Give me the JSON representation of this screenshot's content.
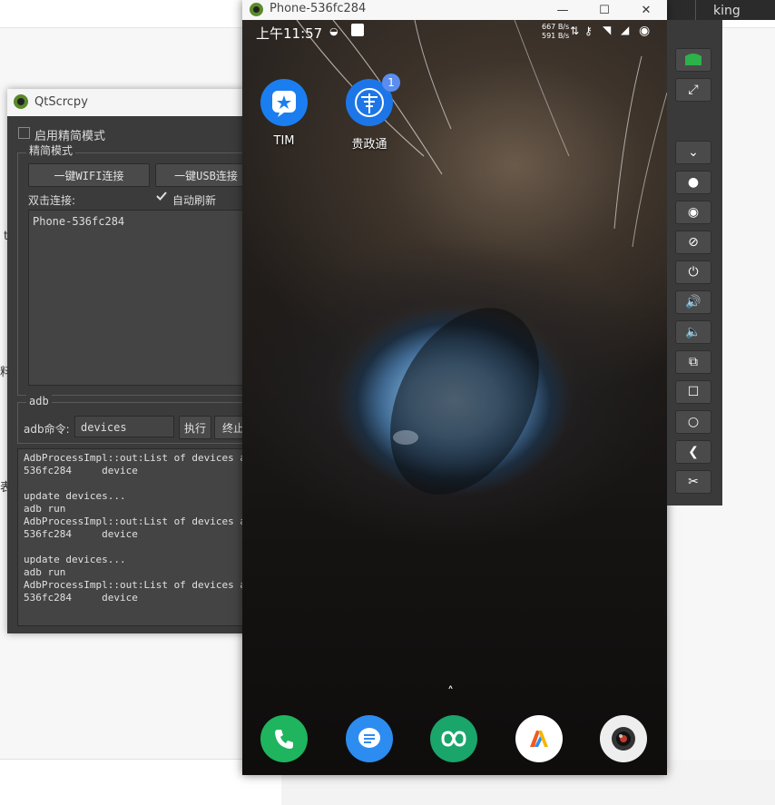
{
  "background": {
    "user_name": "king",
    "fragments": [
      "t",
      "料",
      "表"
    ]
  },
  "qtscrcpy": {
    "title": "QtScrcpy",
    "simple_mode_checkbox": "启用精简模式",
    "group_title": "精简模式",
    "wifi_button": "一键WIFI连接",
    "usb_button": "一键USB连接",
    "double_click_label": "双击连接:",
    "auto_refresh_label": "自动刷新",
    "auto_refresh_checked": true,
    "devices": [
      "Phone-536fc284"
    ],
    "adb_group_title": "adb",
    "adb_command_label": "adb命令:",
    "adb_command_value": "devices",
    "execute_button": "执行",
    "stop_button": "终止",
    "log_lines": [
      "AdbProcessImpl::out:List of devices attached",
      "536fc284     device",
      "",
      "update devices...",
      "adb run",
      "AdbProcessImpl::out:List of devices attached",
      "536fc284     device",
      "",
      "update devices...",
      "adb run",
      "AdbProcessImpl::out:List of devices attached",
      "536fc284     device"
    ]
  },
  "phone_window": {
    "title": "Phone-536fc284",
    "controls": {
      "minimize": "—",
      "maximize": "☐",
      "close": "✕"
    },
    "status_bar": {
      "time": "上午11:57",
      "speed_up": "667 B/s",
      "speed_down": "591 B/s"
    },
    "apps": [
      {
        "label": "TIM",
        "icon": "tim-icon",
        "badge": ""
      },
      {
        "label": "贵政通",
        "icon": "guizhengtong-icon",
        "badge": "1"
      }
    ],
    "dock": [
      {
        "icon": "phone-icon",
        "color": "#1fb45e"
      },
      {
        "icon": "messages-icon",
        "color": "#2d8cf0"
      },
      {
        "icon": "link-app-icon",
        "color": "#1aa56a"
      },
      {
        "icon": "store-icon",
        "color": "#ffffff"
      },
      {
        "icon": "camera-icon",
        "color": "#eeeeee"
      }
    ]
  },
  "toolbar": {
    "buttons": [
      "switch-device-icon",
      "fullscreen-icon",
      "expand-icon",
      "home-dot-icon",
      "show-touches-icon",
      "hide-icon",
      "power-icon",
      "volume-up-icon",
      "volume-down-icon",
      "app-switch-icon",
      "menu-square-icon",
      "circle-home-icon",
      "back-icon",
      "screenshot-scissors-icon"
    ],
    "accent": "#2db14a"
  }
}
